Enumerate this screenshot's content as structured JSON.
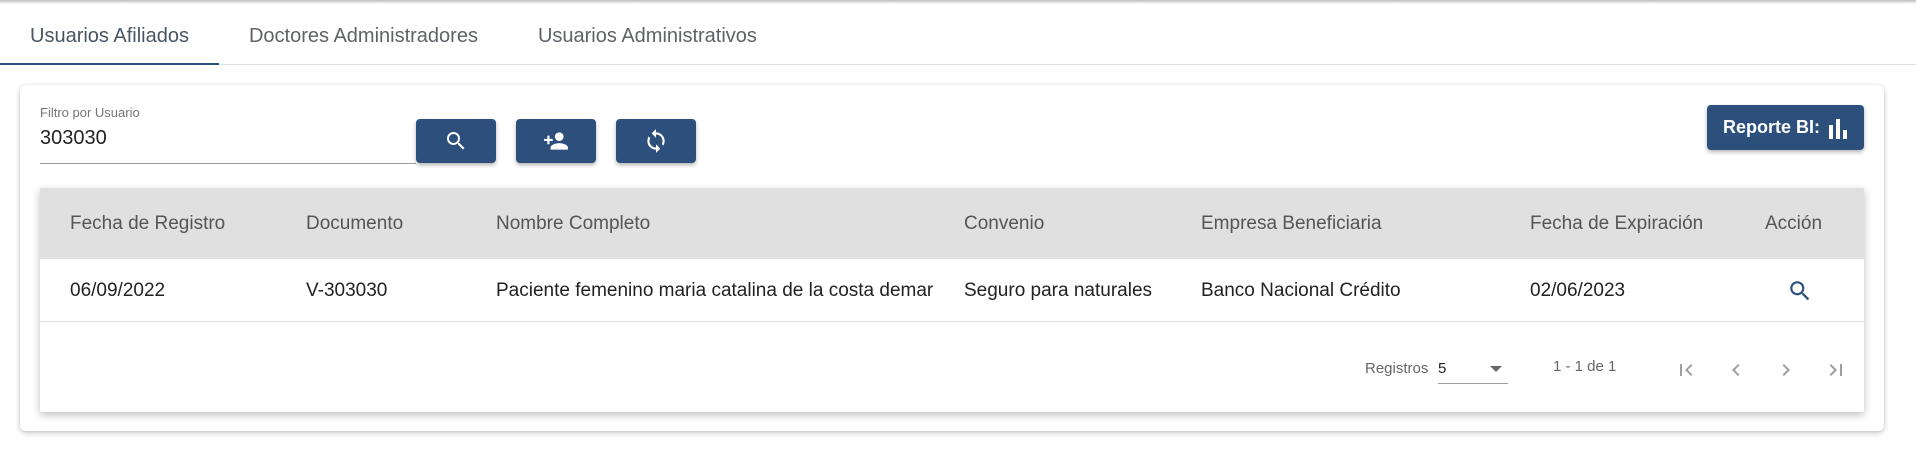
{
  "tabs": [
    {
      "label": "Usuarios Afiliados",
      "active": true
    },
    {
      "label": "Doctores Administradores",
      "active": false
    },
    {
      "label": "Usuarios Administrativos",
      "active": false
    }
  ],
  "filter": {
    "label": "Filtro por Usuario",
    "value": "303030"
  },
  "buttons": {
    "search_icon": "search-icon",
    "add_icon": "person-add-icon",
    "refresh_icon": "refresh-icon",
    "report_label": "Reporte BI:",
    "report_icon": "bar-chart-icon"
  },
  "table": {
    "headers": [
      "Fecha de Registro",
      "Documento",
      "Nombre Completo",
      "Convenio",
      "Empresa Beneficiaria",
      "Fecha de Expiración",
      "Acción"
    ],
    "rows": [
      {
        "fecha_registro": "06/09/2022",
        "documento": "V-303030",
        "nombre": "Paciente femenino maria catalina de la costa demar",
        "convenio": "Seguro para naturales",
        "empresa": "Banco Nacional Crédito",
        "fecha_expiracion": "02/06/2023",
        "accion_icon": "search-icon"
      }
    ]
  },
  "pager": {
    "label": "Registros",
    "page_size": "5",
    "range": "1 - 1 de 1"
  },
  "colors": {
    "primary": "#2c4f7c",
    "header_bg": "#e0e0e0"
  }
}
